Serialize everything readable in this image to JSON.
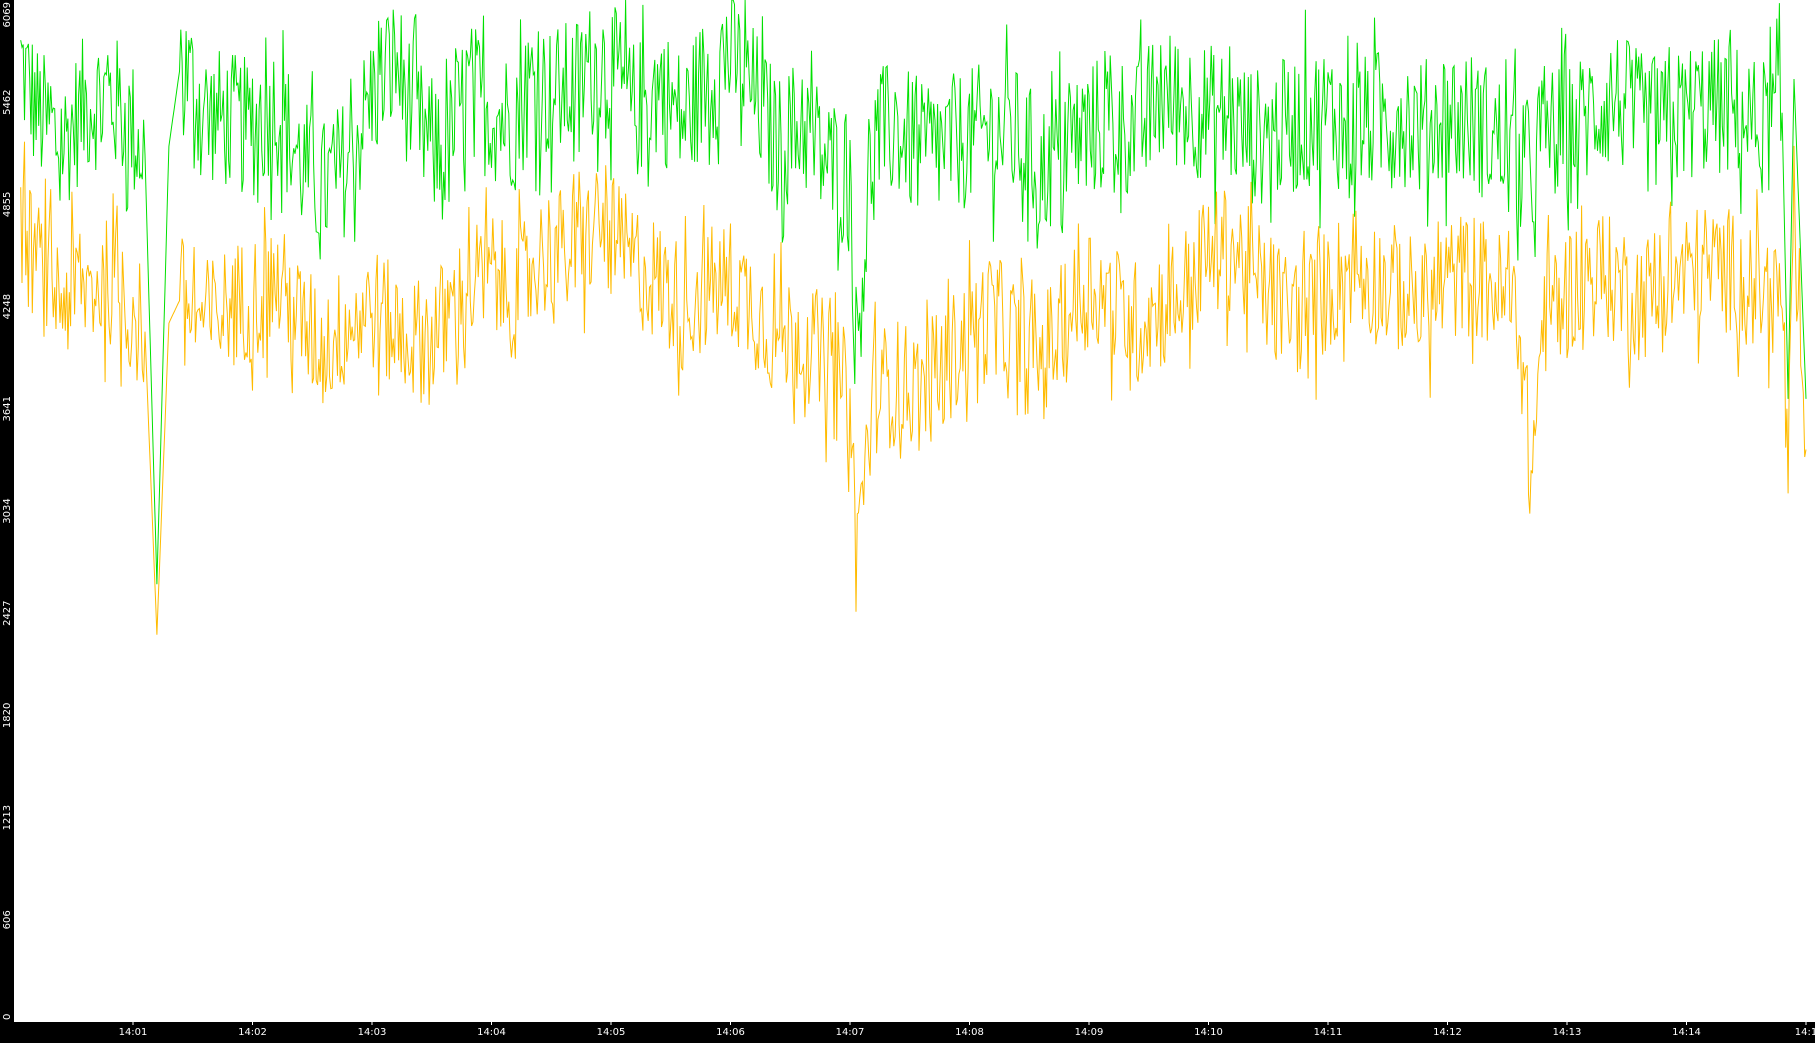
{
  "chart_data": {
    "type": "line",
    "title": "",
    "xlabel": "",
    "ylabel": "",
    "background": "#000000",
    "plot_background": "#ffffff",
    "ylim": [
      0,
      6069
    ],
    "y_ticks": [
      "0",
      "606",
      "1213",
      "1820",
      "2427",
      "3034",
      "3641",
      "4248",
      "4855",
      "5462",
      "6069"
    ],
    "x_ticks": [
      {
        "minute": 1,
        "label": "14:01"
      },
      {
        "minute": 2,
        "label": "14:02"
      },
      {
        "minute": 3,
        "label": "14:03"
      },
      {
        "minute": 4,
        "label": "14:04"
      },
      {
        "minute": 5,
        "label": "14:05"
      },
      {
        "minute": 6,
        "label": "14:06"
      },
      {
        "minute": 7,
        "label": "14:07"
      },
      {
        "minute": 8,
        "label": "14:08"
      },
      {
        "minute": 9,
        "label": "14:09"
      },
      {
        "minute": 10,
        "label": "14:10"
      },
      {
        "minute": 11,
        "label": "14:11"
      },
      {
        "minute": 12,
        "label": "14:12"
      },
      {
        "minute": 13,
        "label": "14:13"
      },
      {
        "minute": 14,
        "label": "14:14"
      },
      {
        "minute": 15,
        "label": "14:1"
      }
    ],
    "xlim_minutes": [
      0.06,
      15.0
    ],
    "series": [
      {
        "color": "#00e000",
        "x": [
          0.06,
          0.2,
          0.4,
          0.6,
          0.8,
          1.0,
          1.1,
          1.2,
          1.3,
          1.4,
          1.6,
          1.8,
          2.0,
          2.2,
          2.4,
          2.6,
          2.8,
          3.0,
          3.2,
          3.4,
          3.6,
          3.8,
          4.0,
          4.2,
          4.35,
          4.5,
          4.7,
          4.9,
          5.0,
          5.2,
          5.4,
          5.6,
          5.8,
          6.0,
          6.2,
          6.4,
          6.6,
          6.8,
          7.0,
          7.05,
          7.2,
          7.4,
          7.6,
          7.8,
          8.0,
          8.2,
          8.4,
          8.6,
          8.8,
          9.0,
          9.2,
          9.4,
          9.6,
          9.8,
          10.0,
          10.2,
          10.4,
          10.6,
          10.8,
          11.0,
          11.2,
          11.4,
          11.6,
          11.8,
          12.0,
          12.2,
          12.4,
          12.6,
          12.7,
          12.8,
          13.0,
          13.2,
          13.4,
          13.6,
          13.8,
          14.0,
          14.2,
          14.4,
          14.6,
          14.8,
          14.85,
          14.9,
          15.0
        ],
        "y": [
          5700,
          5400,
          5200,
          5450,
          5500,
          5300,
          5150,
          2600,
          5200,
          5700,
          5400,
          5350,
          5300,
          5450,
          5100,
          4950,
          5100,
          5500,
          5700,
          5300,
          5100,
          5550,
          5400,
          5350,
          5600,
          5500,
          5550,
          5700,
          5650,
          5400,
          5550,
          5350,
          5600,
          5750,
          5500,
          5200,
          5350,
          5100,
          5050,
          4000,
          5250,
          5300,
          5150,
          5200,
          5250,
          5300,
          5250,
          5050,
          5200,
          5300,
          5350,
          5300,
          5500,
          5450,
          5400,
          5350,
          5250,
          5300,
          5350,
          5400,
          5300,
          5350,
          5400,
          5300,
          5400,
          5350,
          5250,
          5100,
          5000,
          5300,
          5250,
          5400,
          5500,
          5350,
          5300,
          5400,
          5450,
          5400,
          5300,
          5400,
          3700,
          5600,
          3700
        ]
      },
      {
        "color": "#ffbb00",
        "x": [
          0.06,
          0.2,
          0.4,
          0.6,
          0.8,
          1.0,
          1.1,
          1.2,
          1.3,
          1.4,
          1.6,
          1.8,
          2.0,
          2.2,
          2.4,
          2.6,
          2.8,
          3.0,
          3.2,
          3.4,
          3.6,
          3.8,
          4.0,
          4.2,
          4.35,
          4.5,
          4.7,
          4.9,
          5.0,
          5.2,
          5.4,
          5.6,
          5.8,
          6.0,
          6.2,
          6.4,
          6.6,
          6.8,
          7.0,
          7.05,
          7.2,
          7.4,
          7.6,
          7.8,
          8.0,
          8.2,
          8.4,
          8.6,
          8.8,
          9.0,
          9.2,
          9.4,
          9.6,
          9.8,
          10.0,
          10.2,
          10.4,
          10.6,
          10.8,
          11.0,
          11.2,
          11.4,
          11.6,
          11.8,
          12.0,
          12.2,
          12.4,
          12.6,
          12.7,
          12.8,
          13.0,
          13.2,
          13.4,
          13.6,
          13.8,
          14.0,
          14.2,
          14.4,
          14.6,
          14.8,
          14.85,
          14.9,
          15.0
        ],
        "y": [
          4700,
          4500,
          4300,
          4350,
          4400,
          4200,
          4100,
          2300,
          4150,
          4300,
          4150,
          4250,
          4300,
          4400,
          4150,
          4000,
          4150,
          4250,
          4100,
          4050,
          4150,
          4350,
          4450,
          4300,
          4500,
          4600,
          4550,
          4750,
          4650,
          4500,
          4400,
          4250,
          4350,
          4400,
          4250,
          4050,
          4100,
          3900,
          3700,
          2800,
          3750,
          3800,
          3750,
          3900,
          4100,
          4200,
          4000,
          3950,
          4150,
          4400,
          4250,
          4150,
          4250,
          4350,
          4550,
          4600,
          4400,
          4250,
          4200,
          4350,
          4500,
          4400,
          4350,
          4250,
          4400,
          4450,
          4350,
          4200,
          3200,
          4200,
          4350,
          4450,
          4400,
          4300,
          4350,
          4450,
          4500,
          4450,
          4350,
          4300,
          3250,
          4600,
          3400
        ]
      }
    ]
  }
}
